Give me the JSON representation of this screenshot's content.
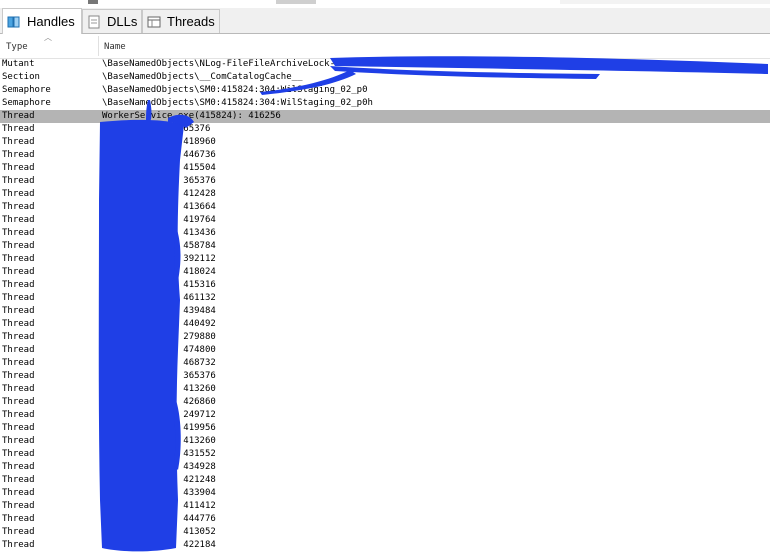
{
  "tabs": [
    {
      "label": "Handles",
      "icon": "handles-icon",
      "active": true
    },
    {
      "label": "DLLs",
      "icon": "dlls-icon",
      "active": false
    },
    {
      "label": "Threads",
      "icon": "threads-icon",
      "active": false
    }
  ],
  "columns": {
    "type": "Type",
    "name": "Name"
  },
  "rows": [
    {
      "type": "Mutant",
      "name": "\\BaseNamedObjects\\NLog-FileFileArchiveLock-c:"
    },
    {
      "type": "Section",
      "name": "\\BaseNamedObjects\\__ComCatalogCache__"
    },
    {
      "type": "Semaphore",
      "name": "\\BaseNamedObjects\\SM0:415824:304:WilStaging_02_p0"
    },
    {
      "type": "Semaphore",
      "name": "\\BaseNamedObjects\\SM0:415824:304:WilStaging_02_p0h"
    },
    {
      "type": "Thread",
      "name": "WorkerService.exe(415824): 416256"
    },
    {
      "type": "Thread",
      "name": ".exe(415824): 365376"
    },
    {
      "type": "Thread",
      "name": "e.exe(415824): 418960"
    },
    {
      "type": "Thread",
      "name": "e.exe(415824): 446736"
    },
    {
      "type": "Thread",
      "name": "e.exe(415824): 415504"
    },
    {
      "type": "Thread",
      "name": "e.exe(415824): 365376"
    },
    {
      "type": "Thread",
      "name": "e.exe(415824): 412428"
    },
    {
      "type": "Thread",
      "name": "e.exe(415824): 413664"
    },
    {
      "type": "Thread",
      "name": "e.exe(415824): 419764"
    },
    {
      "type": "Thread",
      "name": "e.exe(415824): 413436"
    },
    {
      "type": "Thread",
      "name": "e.exe(415824): 458784"
    },
    {
      "type": "Thread",
      "name": "e.exe(415824): 392112"
    },
    {
      "type": "Thread",
      "name": "e.exe(415824): 418024"
    },
    {
      "type": "Thread",
      "name": "e.exe(415824): 415316"
    },
    {
      "type": "Thread",
      "name": "e.exe(415824): 461132"
    },
    {
      "type": "Thread",
      "name": "e.exe(415824): 439484"
    },
    {
      "type": "Thread",
      "name": "e.exe(415824): 440492"
    },
    {
      "type": "Thread",
      "name": "e.exe(415824): 279880"
    },
    {
      "type": "Thread",
      "name": "e.exe(415824): 474800"
    },
    {
      "type": "Thread",
      "name": "e.exe(415824): 468732"
    },
    {
      "type": "Thread",
      "name": "e.exe(415824): 365376"
    },
    {
      "type": "Thread",
      "name": "e.exe(415824): 413260"
    },
    {
      "type": "Thread",
      "name": "e.exe(415824): 426860"
    },
    {
      "type": "Thread",
      "name": "e.exe(415824): 249712"
    },
    {
      "type": "Thread",
      "name": "e.exe(415824): 419956"
    },
    {
      "type": "Thread",
      "name": "e.exe(415824): 413260"
    },
    {
      "type": "Thread",
      "name": "e.exe(415824): 431552"
    },
    {
      "type": "Thread",
      "name": "e.exe(415824): 434928"
    },
    {
      "type": "Thread",
      "name": "e.exe(415824): 421248"
    },
    {
      "type": "Thread",
      "name": "e.exe(415824): 433904"
    },
    {
      "type": "Thread",
      "name": "e.exe(415824): 411412"
    },
    {
      "type": "Thread",
      "name": "e.exe(415824): 444776"
    },
    {
      "type": "Thread",
      "name": "e.exe(415824): 413052"
    },
    {
      "type": "Thread",
      "name": "e.exe(415824): 422184"
    }
  ],
  "selected_row": 4,
  "colors": {
    "selection": "#b4b4b4",
    "redaction": "#1f3fe6",
    "tab_bg": "#f0f0f0"
  }
}
